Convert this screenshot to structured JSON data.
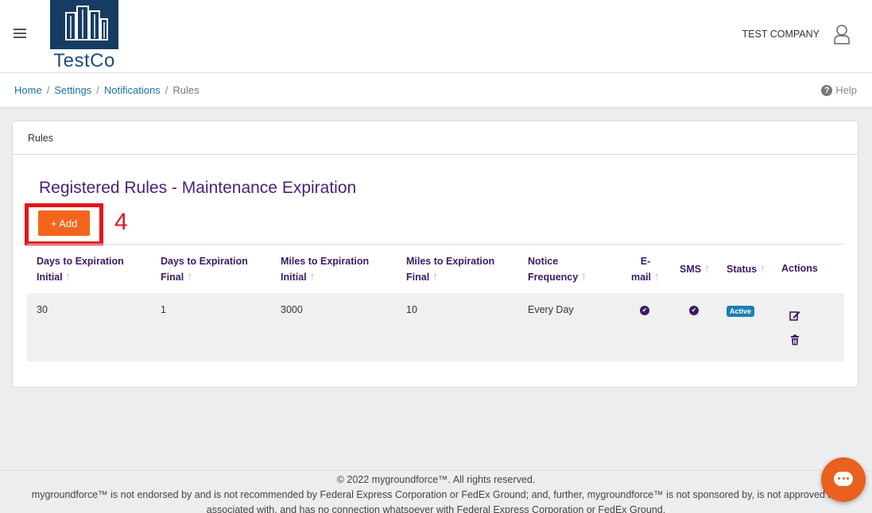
{
  "header": {
    "logo_text": "TestCo",
    "company_name": "TEST COMPANY"
  },
  "breadcrumb": {
    "items": [
      "Home",
      "Settings",
      "Notifications"
    ],
    "current": "Rules",
    "help_label": "Help"
  },
  "card": {
    "header_title": "Rules",
    "section_title": "Registered Rules - Maintenance Expiration",
    "add_button_label": "+ Add",
    "step_number": "4"
  },
  "table": {
    "columns": [
      {
        "line1": "Days to Expiration",
        "line2": "Initial"
      },
      {
        "line1": "Days to Expiration",
        "line2": "Final"
      },
      {
        "line1": "Miles to Expiration",
        "line2": "Initial"
      },
      {
        "line1": "Miles to Expiration",
        "line2": "Final"
      },
      {
        "line1": "Notice",
        "line2": "Frequency"
      },
      {
        "line1": "E-",
        "line2": "mail"
      },
      {
        "line1": "SMS",
        "line2": ""
      },
      {
        "line1": "Status",
        "line2": ""
      },
      {
        "line1": "Actions",
        "line2": ""
      }
    ],
    "rows": [
      {
        "days_initial": "30",
        "days_final": "1",
        "miles_initial": "3000",
        "miles_final": "10",
        "frequency": "Every Day",
        "email": true,
        "sms": true,
        "status": "Active"
      }
    ]
  },
  "footer": {
    "line1": "© 2022 mygroundforce™. All rights reserved.",
    "line2": "mygroundforce™ is not endorsed by and is not recommended by Federal Express Corporation or FedEx Ground; and, further, mygroundforce™ is not sponsored by, is not approved by,",
    "line3": "associated with, and has no connection whatsoever with Federal Express Corporation or FedEx Ground."
  },
  "colors": {
    "brand_navy": "#173c63",
    "title_purple": "#4a1f7a",
    "add_orange": "#f4651b",
    "highlight_red": "#e5141c",
    "status_blue": "#1a7fb5"
  }
}
